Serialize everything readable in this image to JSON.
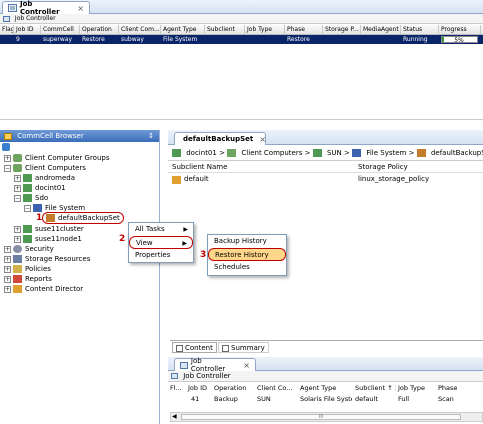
{
  "top_job_controller": {
    "tab_label": "Job Controller",
    "subheader": "Job Controller",
    "columns": [
      "Flags",
      "Job ID",
      "CommCell",
      "Operation",
      "Client Com...",
      "Agent Type",
      "Subclient",
      "Job Type",
      "Phase",
      "Storage P...",
      "MediaAgent",
      "Status",
      "Progress"
    ],
    "row": [
      "",
      "9",
      "superway",
      "Restore",
      "subway",
      "File System",
      "",
      "",
      "Restore",
      "",
      "",
      "Running",
      "5%"
    ],
    "progress_fraction": 0.05
  },
  "commcell_browser": {
    "title": "CommCell Browser",
    "pin": "↕",
    "tree": [
      {
        "label": "",
        "icon": "commcell-icon"
      },
      {
        "label": "Client Computer Groups",
        "icon": "client-groups-icon"
      },
      {
        "label": "Client Computers",
        "icon": "client-computers-icon"
      },
      {
        "label": "andromeda",
        "icon": "client-icon"
      },
      {
        "label": "docint01",
        "icon": "client-icon"
      },
      {
        "label": "Sdo",
        "icon": "client-icon"
      },
      {
        "label": "File System",
        "icon": "file-system-icon"
      },
      {
        "label": "defaultBackupSet",
        "icon": "backupset-icon"
      },
      {
        "label": "suse11cluster",
        "icon": "client-icon"
      },
      {
        "label": "suse11node1",
        "icon": "client-icon"
      },
      {
        "label": "Security",
        "icon": "security-icon"
      },
      {
        "label": "Storage Resources",
        "icon": "storage-icon"
      },
      {
        "label": "Policies",
        "icon": "policies-icon"
      },
      {
        "label": "Reports",
        "icon": "reports-icon"
      },
      {
        "label": "Content Director",
        "icon": "content-director-icon"
      }
    ]
  },
  "context_menu": {
    "items": [
      "All Tasks",
      "View",
      "Properties"
    ],
    "submenu": [
      "Backup History",
      "Restore History",
      "Schedules"
    ]
  },
  "callouts": {
    "one": "1",
    "two": "2",
    "three": "3"
  },
  "backupset_panel": {
    "tab_label": "defaultBackupSet",
    "breadcrumb": [
      "docint01",
      "Client Computers",
      "SUN",
      "File System",
      "defaultBackupSet"
    ],
    "sep": ">",
    "col_subclient": "Subclient Name",
    "col_storage": "Storage Policy",
    "row_subclient": "default",
    "row_storage": "linux_storage_policy",
    "bottom_tabs": [
      "Content",
      "Summary"
    ]
  },
  "bottom_job_controller": {
    "tab_label": "Job Controller",
    "subheader": "Job Controller",
    "columns": [
      "Fl...",
      "Job ID",
      "Operation",
      "Client Co...",
      "Agent Type",
      "Subclient ↑ 1",
      "Job Type",
      "Phase"
    ],
    "row": [
      "",
      "41",
      "Backup",
      "SUN",
      "Solaris File System",
      "default",
      "Full",
      "Scan"
    ],
    "scroll_grip": "III"
  },
  "colors": {
    "selection": "#0a246a",
    "highlight": "#ffd78a",
    "callout": "#c00000",
    "accent": "#8fa6c7"
  }
}
